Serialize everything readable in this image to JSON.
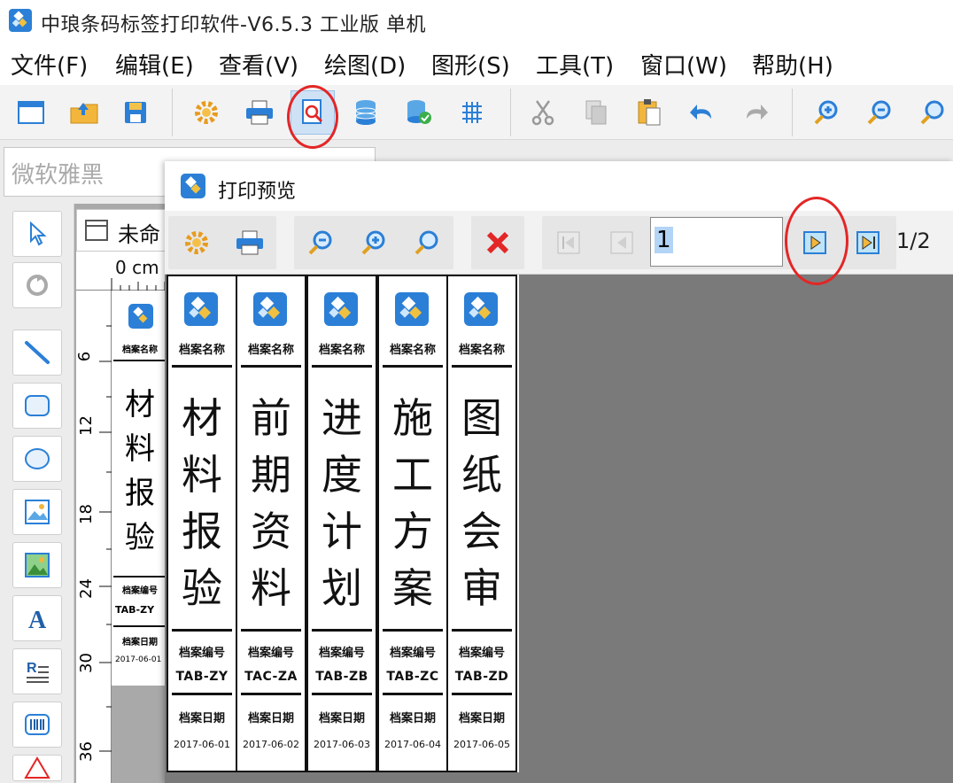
{
  "app": {
    "title": "中琅条码标签打印软件-V6.5.3 工业版 单机"
  },
  "menu": [
    {
      "label": "文件(F)"
    },
    {
      "label": "编辑(E)"
    },
    {
      "label": "查看(V)"
    },
    {
      "label": "绘图(D)"
    },
    {
      "label": "图形(S)"
    },
    {
      "label": "工具(T)"
    },
    {
      "label": "窗口(W)"
    },
    {
      "label": "帮助(H)"
    }
  ],
  "font_combo": {
    "value": "微软雅黑"
  },
  "document": {
    "tab_title": "未命",
    "ruler_unit": "0 cm",
    "ruler_ticks": [
      "6",
      "12",
      "18",
      "24",
      "30",
      "36"
    ],
    "label": {
      "head": "档案名称",
      "chars": [
        "材",
        "料",
        "报",
        "验"
      ],
      "code_head": "档案编号",
      "code": "TAB-ZY",
      "date_head": "档案日期",
      "date": "2017-06-01"
    }
  },
  "preview": {
    "title": "打印预览",
    "page_input": "1",
    "page_count": "1/2",
    "labels": [
      {
        "head": "档案名称",
        "chars": [
          "材",
          "料",
          "报",
          "验"
        ],
        "code_head": "档案编号",
        "code": "TAB-ZY",
        "date_head": "档案日期",
        "date": "2017-06-01"
      },
      {
        "head": "档案名称",
        "chars": [
          "前",
          "期",
          "资",
          "料"
        ],
        "code_head": "档案编号",
        "code": "TAC-ZA",
        "date_head": "档案日期",
        "date": "2017-06-02"
      },
      {
        "head": "档案名称",
        "chars": [
          "进",
          "度",
          "计",
          "划"
        ],
        "code_head": "档案编号",
        "code": "TAB-ZB",
        "date_head": "档案日期",
        "date": "2017-06-03"
      },
      {
        "head": "档案名称",
        "chars": [
          "施",
          "工",
          "方",
          "案"
        ],
        "code_head": "档案编号",
        "code": "TAB-ZC",
        "date_head": "档案日期",
        "date": "2017-06-04"
      },
      {
        "head": "档案名称",
        "chars": [
          "图",
          "纸",
          "会",
          "审"
        ],
        "code_head": "档案编号",
        "code": "TAB-ZD",
        "date_head": "档案日期",
        "date": "2017-06-05"
      }
    ]
  },
  "colors": {
    "accent_blue": "#2b7fd6",
    "highlight_red": "#e32626",
    "preview_bg": "#7a7a7a"
  }
}
